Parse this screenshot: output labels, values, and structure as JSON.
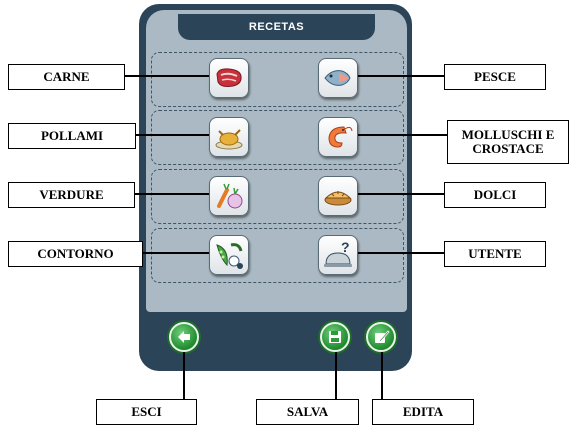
{
  "screen": {
    "title": "RECETAS"
  },
  "categories": {
    "carne": "CARNE",
    "pesce": "PESCE",
    "pollami": "POLLAMI",
    "molluschi": "MOLLUSCHI E CROSTACE",
    "verdure": "VERDURE",
    "dolci": "DOLCI",
    "contorno": "CONTORNO",
    "utente": "UTENTE"
  },
  "actions": {
    "esci": "ESCI",
    "salva": "SALVA",
    "edita": "EDITA"
  },
  "colors": {
    "device_frame": "#2b4458",
    "panel": "#aab9c3",
    "action_button": "#2e9a3c"
  },
  "icons": {
    "carne": "meat-steak-icon",
    "pesce": "fish-icon",
    "pollami": "roast-chicken-icon",
    "molluschi": "shrimp-icon",
    "verdure": "vegetables-icon",
    "dolci": "pie-icon",
    "contorno": "side-dish-peas-icon",
    "utente": "cloche-question-icon",
    "esci": "back-arrow-icon",
    "salva": "floppy-disk-icon",
    "edita": "edit-pencil-icon"
  }
}
